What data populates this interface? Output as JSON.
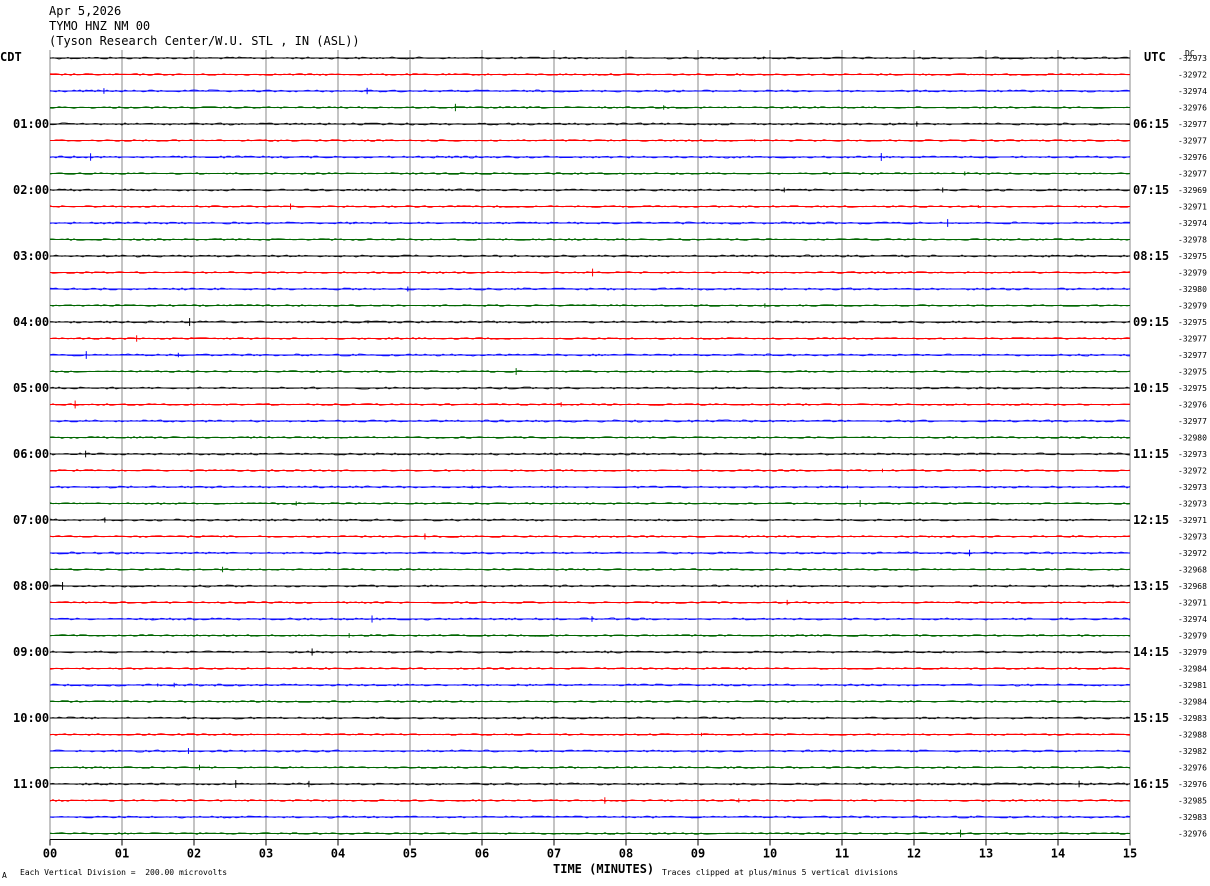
{
  "header": {
    "date": "Apr 5,2026",
    "station": "TYMO HNZ NM 00",
    "location": "(Tyson Research Center/W.U. STL , IN (ASL))"
  },
  "left_axis_label": "CDT",
  "right_axis_label": "UTC",
  "right_top_label": "DC",
  "footer": {
    "scale_note": "Each Vertical Division =  200.00 microvolts",
    "clip_note": "Traces clipped at plus/minus 5 vertical divisions",
    "corner_mark": "A"
  },
  "chart_data": {
    "type": "line",
    "title": "",
    "xlabel": "TIME (MINUTES)",
    "ylabel": "",
    "x_ticks": [
      "00",
      "01",
      "02",
      "03",
      "04",
      "05",
      "06",
      "07",
      "08",
      "09",
      "10",
      "11",
      "12",
      "13",
      "14",
      "15"
    ],
    "xlim": [
      0,
      15
    ],
    "trace_minutes": 15,
    "trace_colors": [
      "#000000",
      "#ff0000",
      "#0000ff",
      "#006600"
    ],
    "grid": true,
    "cdt_hour_labels": [
      "01:00",
      "02:00",
      "03:00",
      "04:00",
      "05:00",
      "06:00",
      "07:00",
      "08:00",
      "09:00",
      "10:00",
      "11:00"
    ],
    "utc_hour_labels": [
      "06:15",
      "07:15",
      "08:15",
      "09:15",
      "10:15",
      "11:15",
      "12:15",
      "13:15",
      "14:15",
      "15:15",
      "16:15"
    ],
    "trace_dc_offsets": [
      -32973,
      -32972,
      -32974,
      -32976,
      -32977,
      -32977,
      -32976,
      -32977,
      -32969,
      -32971,
      -32974,
      -32978,
      -32975,
      -32979,
      -32980,
      -32979,
      -32975,
      -32977,
      -32977,
      -32975,
      -32975,
      -32976,
      -32977,
      -32980,
      -32973,
      -32972,
      -32973,
      -32973,
      -32971,
      -32973,
      -32972,
      -32968,
      -32968,
      -32971,
      -32974,
      -32979,
      -32979,
      -32984,
      -32981,
      -32984,
      -32983,
      -32988,
      -32982,
      -32976,
      -32976,
      -32985,
      -32983,
      -32976
    ]
  }
}
